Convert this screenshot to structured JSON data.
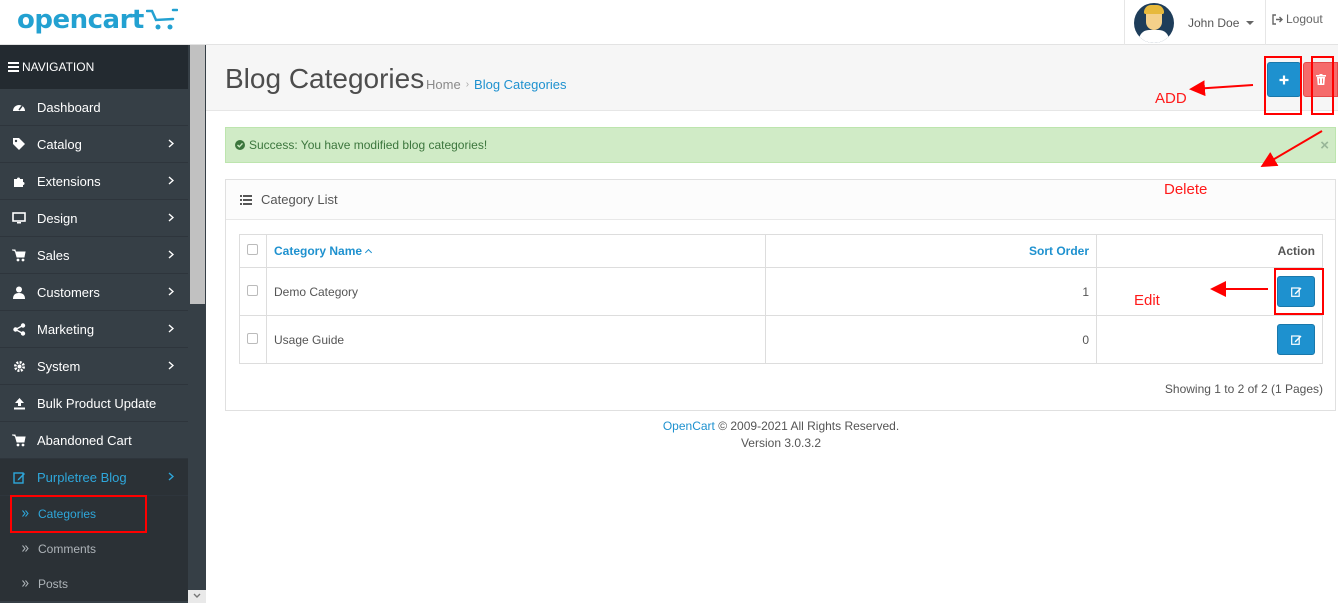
{
  "header": {
    "logo_text": "opencart",
    "user_name": "John Doe",
    "logout_label": "Logout"
  },
  "sidebar": {
    "nav_title": "NAVIGATION",
    "items": [
      {
        "label": "Dashboard",
        "icon": "dashboard-icon"
      },
      {
        "label": "Catalog",
        "icon": "tag-icon"
      },
      {
        "label": "Extensions",
        "icon": "puzzle-icon"
      },
      {
        "label": "Design",
        "icon": "monitor-icon"
      },
      {
        "label": "Sales",
        "icon": "cart-icon"
      },
      {
        "label": "Customers",
        "icon": "user-icon"
      },
      {
        "label": "Marketing",
        "icon": "share-icon"
      },
      {
        "label": "System",
        "icon": "gear-icon"
      },
      {
        "label": "Bulk Product Update",
        "icon": "upload-icon"
      },
      {
        "label": "Abandoned Cart",
        "icon": "cart-icon"
      },
      {
        "label": "Purpletree Blog",
        "icon": "edit-icon"
      }
    ],
    "subitems": [
      {
        "label": "Categories"
      },
      {
        "label": "Comments"
      },
      {
        "label": "Posts"
      }
    ]
  },
  "page": {
    "title": "Blog Categories",
    "breadcrumb_home": "Home",
    "breadcrumb_sep": "›",
    "breadcrumb_current": "Blog Categories"
  },
  "alert": {
    "message": "Success: You have modified blog categories!",
    "close": "×"
  },
  "panel": {
    "title": "Category List",
    "columns": [
      "Category Name",
      "Sort Order",
      "Action"
    ],
    "rows": [
      {
        "name": "Demo Category",
        "sort_order": "1"
      },
      {
        "name": "Usage Guide",
        "sort_order": "0"
      }
    ],
    "pagination": "Showing 1 to 2 of 2 (1 Pages)"
  },
  "footer": {
    "link": "OpenCart",
    "copyright": " © 2009-2021 All Rights Reserved.",
    "version": "Version 3.0.3.2"
  },
  "annotations": {
    "add": "ADD",
    "delete": "Delete",
    "edit": "Edit"
  },
  "colors": {
    "primary": "#1e91cf",
    "danger": "#f56b6b",
    "sidebar_bg": "#363f46",
    "annotation": "#ff0000"
  }
}
